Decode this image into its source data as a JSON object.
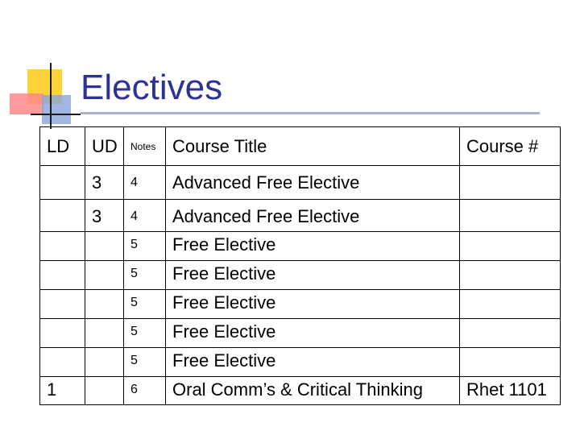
{
  "slide": {
    "title": "Electives"
  },
  "table": {
    "headers": {
      "ld": "LD",
      "ud": "UD",
      "notes": "Notes",
      "title": "Course Title",
      "course_num": "Course #"
    },
    "rows": [
      {
        "ld": "",
        "ud": "3",
        "notes": "4",
        "title": "Advanced Free Elective",
        "course_num": ""
      },
      {
        "ld": "",
        "ud": "3",
        "notes": "4",
        "title": "Advanced Free Elective",
        "course_num": ""
      },
      {
        "ld": "",
        "ud": "",
        "notes": "5",
        "title": "Free Elective",
        "course_num": ""
      },
      {
        "ld": "",
        "ud": "",
        "notes": "5",
        "title": "Free Elective",
        "course_num": ""
      },
      {
        "ld": "",
        "ud": "",
        "notes": "5",
        "title": "Free Elective",
        "course_num": ""
      },
      {
        "ld": "",
        "ud": "",
        "notes": "5",
        "title": "Free Elective",
        "course_num": ""
      },
      {
        "ld": "",
        "ud": "",
        "notes": "5",
        "title": "Free Elective",
        "course_num": ""
      },
      {
        "ld": "1",
        "ud": "",
        "notes": "6",
        "title": "Oral Comm’s & Critical Thinking",
        "course_num": "Rhet 1101"
      }
    ]
  },
  "colors": {
    "title": "#2e3196",
    "accent_yellow": "#ffd23a",
    "accent_red": "#ff8a8a",
    "accent_blue": "#8aa4dc"
  }
}
